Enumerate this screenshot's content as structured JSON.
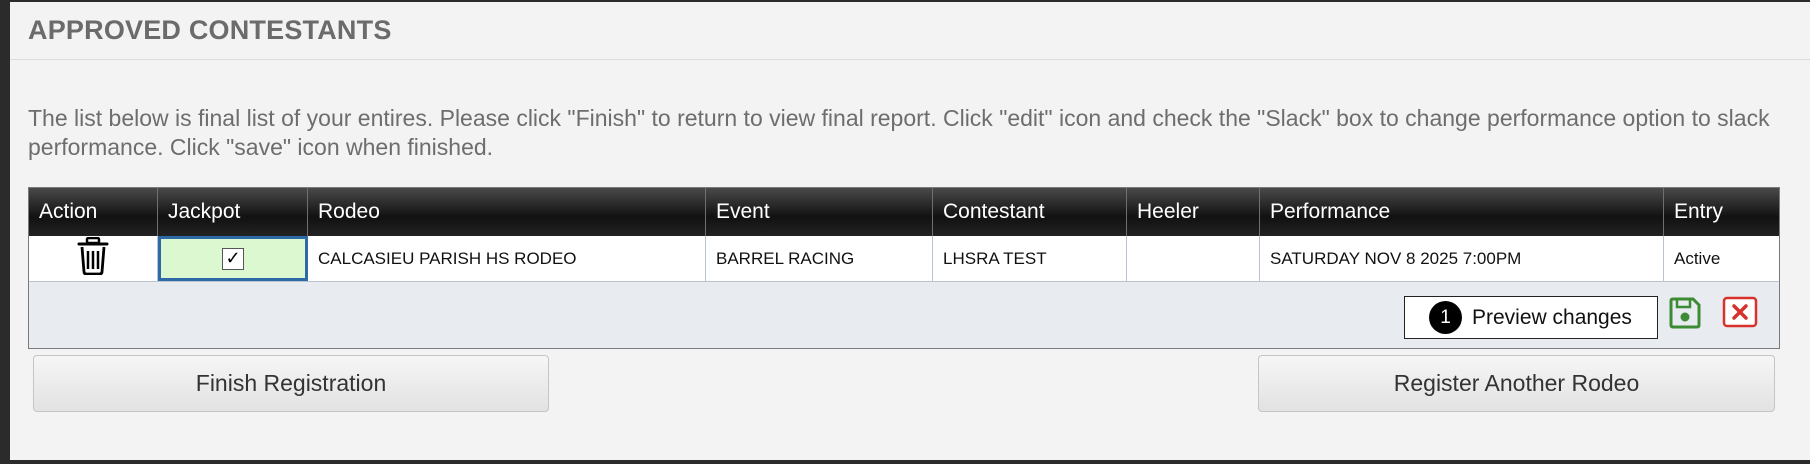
{
  "header": {
    "title": "APPROVED CONTESTANTS"
  },
  "instructions": "The list below is final list of your entires. Please click \"Finish\" to return to view final report. Click \"edit\" icon and check the \"Slack\" box to change performance option to slack performance. Click \"save\" icon when finished.",
  "table": {
    "columns": [
      "Action",
      "Jackpot",
      "Rodeo",
      "Event",
      "Contestant",
      "Heeler",
      "Performance",
      "Entry"
    ],
    "rows": [
      {
        "action_icon": "trash-icon",
        "jackpot_checked": "✓",
        "rodeo": "CALCASIEU PARISH HS RODEO",
        "event": "BARREL RACING",
        "contestant": "LHSRA TEST",
        "heeler": "",
        "performance": "SATURDAY NOV 8 2025 7:00PM",
        "entry": "Active"
      }
    ]
  },
  "edit_row": {
    "preview_badge": "1",
    "preview_label": "Preview changes",
    "save_icon": "save-icon",
    "cancel_icon": "close-icon",
    "colors": {
      "save": "#3d8b34",
      "cancel": "#d9312b"
    }
  },
  "buttons": {
    "finish": "Finish Registration",
    "another": "Register Another Rodeo"
  }
}
